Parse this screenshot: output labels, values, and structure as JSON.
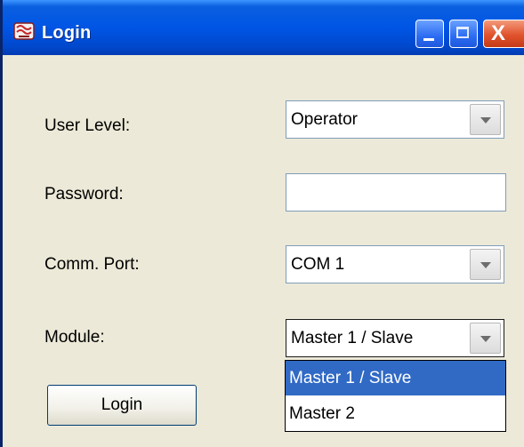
{
  "window": {
    "title": "Login",
    "controls": {
      "minimize": "minimize",
      "maximize": "maximize",
      "close": "X"
    }
  },
  "form": {
    "user_level": {
      "label": "User Level:",
      "value": "Operator"
    },
    "password": {
      "label": "Password:",
      "value": ""
    },
    "comm_port": {
      "label": "Comm. Port:",
      "value": "COM 1"
    },
    "module": {
      "label": "Module:",
      "value": "Master 1 / Slave",
      "options": [
        "Master 1 / Slave",
        "Master 2"
      ],
      "highlighted_option": "Master 1 / Slave",
      "expanded": true
    }
  },
  "buttons": {
    "login_label": "Login"
  },
  "icons": [
    "app-icon",
    "minimize-icon",
    "maximize-icon",
    "close-icon",
    "dropdown-arrow-icon"
  ],
  "colors": {
    "titlebar": "#0055e5",
    "window_bg": "#ece9d8",
    "selection": "#316ac5",
    "close_btn": "#e0532c"
  }
}
